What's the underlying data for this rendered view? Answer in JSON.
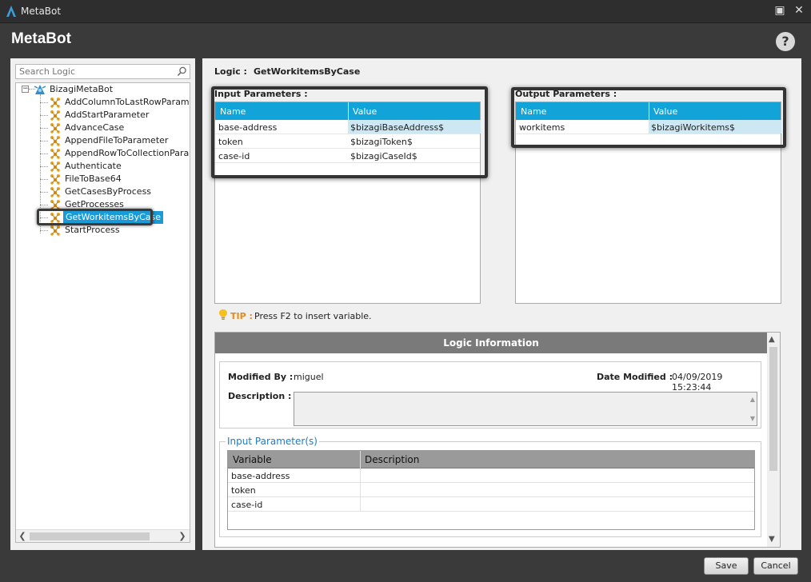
{
  "window": {
    "title": "MetaBot"
  },
  "header": {
    "title": "MetaBot"
  },
  "search": {
    "placeholder": "Search Logic"
  },
  "tree": {
    "root": "BizagiMetaBot",
    "items": [
      "AddColumnToLastRowParameter",
      "AddStartParameter",
      "AdvanceCase",
      "AppendFileToParameter",
      "AppendRowToCollectionParameter",
      "Authenticate",
      "FileToBase64",
      "GetCasesByProcess",
      "GetProcesses",
      "GetWorkitemsByCase",
      "StartProcess"
    ],
    "selected_index": 9
  },
  "logic": {
    "label": "Logic :",
    "name": "GetWorkitemsByCase"
  },
  "input_params": {
    "caption": "Input Parameters :",
    "columns": [
      "Name",
      "Value"
    ],
    "rows": [
      {
        "name": "base-address",
        "value": "$bizagiBaseAddress$"
      },
      {
        "name": "token",
        "value": "$bizagiToken$"
      },
      {
        "name": "case-id",
        "value": "$bizagiCaseId$"
      }
    ]
  },
  "output_params": {
    "caption": "Output Parameters :",
    "columns": [
      "Name",
      "Value"
    ],
    "rows": [
      {
        "name": "workitems",
        "value": "$bizagiWorkitems$"
      }
    ]
  },
  "tip": {
    "label": "TIP :",
    "text": "Press F2 to insert variable."
  },
  "info": {
    "title": "Logic Information",
    "modified_by_label": "Modified By :",
    "modified_by": "miguel",
    "date_modified_label": "Date Modified :",
    "date_modified": "04/09/2019 15:23:44",
    "description_label": "Description :",
    "description": "",
    "input_section_title": "Input Parameter(s)",
    "columns": [
      "Variable",
      "Description"
    ],
    "rows": [
      {
        "variable": "base-address",
        "description": ""
      },
      {
        "variable": "token",
        "description": ""
      },
      {
        "variable": "case-id",
        "description": ""
      }
    ]
  },
  "buttons": {
    "save": "Save",
    "cancel": "Cancel"
  },
  "colors": {
    "accent": "#12a3d8",
    "selection": "#1a9bd7",
    "node_icon": "#e8a21c",
    "tip": "#e88a1a",
    "link": "#1a7ec3"
  }
}
